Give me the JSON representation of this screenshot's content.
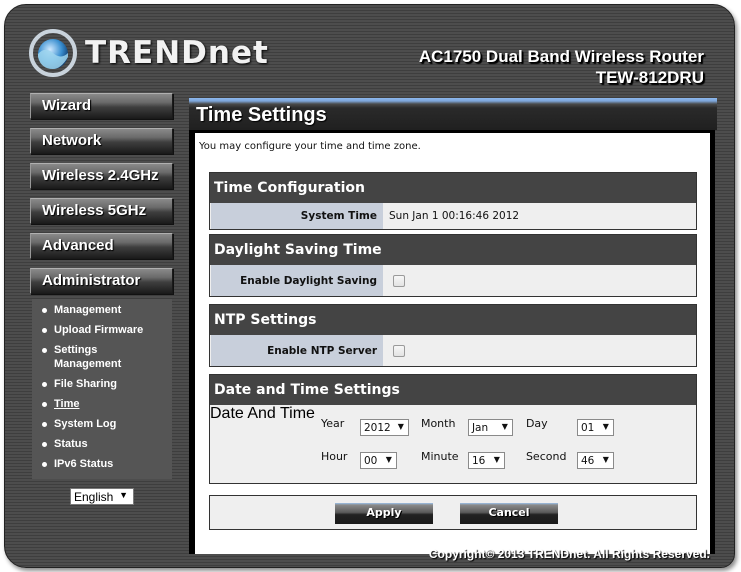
{
  "header": {
    "brand": "TRENDnet",
    "product_line1": "AC1750 Dual Band Wireless Router",
    "product_line2": "TEW-812DRU"
  },
  "sidebar": {
    "nav": [
      {
        "label": "Wizard"
      },
      {
        "label": "Network"
      },
      {
        "label": "Wireless 2.4GHz"
      },
      {
        "label": "Wireless 5GHz"
      },
      {
        "label": "Advanced"
      },
      {
        "label": "Administrator"
      }
    ],
    "submenu": [
      {
        "label": "Management"
      },
      {
        "label": "Upload Firmware"
      },
      {
        "label": "Settings Management"
      },
      {
        "label": "File Sharing"
      },
      {
        "label": "Time",
        "active": true
      },
      {
        "label": "System Log"
      },
      {
        "label": "Status"
      },
      {
        "label": "IPv6 Status"
      }
    ],
    "language": "English"
  },
  "page": {
    "title": "Time Settings",
    "intro": "You may configure your time and time zone."
  },
  "time_config": {
    "title": "Time Configuration",
    "system_time_label": "System Time",
    "system_time_value": "Sun Jan 1 00:16:46 2012"
  },
  "dst": {
    "title": "Daylight Saving Time",
    "enable_label": "Enable Daylight Saving",
    "enabled": false
  },
  "ntp": {
    "title": "NTP Settings",
    "enable_label": "Enable NTP Server",
    "enabled": false
  },
  "datetime": {
    "title": "Date and Time Settings",
    "label": "Date And Time",
    "year_label": "Year",
    "year": "2012",
    "month_label": "Month",
    "month": "Jan",
    "day_label": "Day",
    "day": "01",
    "hour_label": "Hour",
    "hour": "00",
    "minute_label": "Minute",
    "minute": "16",
    "second_label": "Second",
    "second": "46"
  },
  "actions": {
    "apply": "Apply",
    "cancel": "Cancel"
  },
  "footer": {
    "copyright": "Copyright© 2013 TRENDnet. All Rights Reserved."
  },
  "icons": {
    "dropdown_arrow": "▼"
  }
}
